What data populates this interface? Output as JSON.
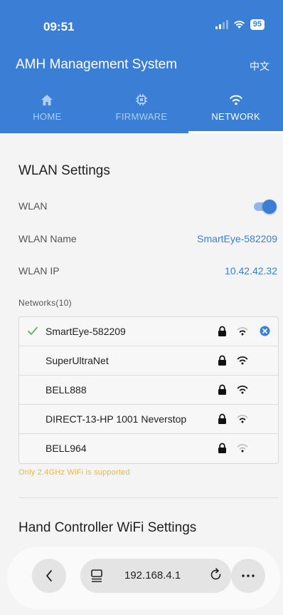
{
  "status_bar": {
    "time": "09:51",
    "battery": "95"
  },
  "app": {
    "title": "AMH Management System",
    "language": "中文"
  },
  "tabs": [
    {
      "label": "HOME",
      "icon": "home-icon"
    },
    {
      "label": "FIRMWARE",
      "icon": "chip-icon"
    },
    {
      "label": "NETWORK",
      "icon": "wifi-icon",
      "active": true
    }
  ],
  "wlan": {
    "section_title": "WLAN Settings",
    "toggle_label": "WLAN",
    "toggle_on": true,
    "name_label": "WLAN Name",
    "name_value": "SmartEye-582209",
    "ip_label": "WLAN IP",
    "ip_value": "10.42.42.32",
    "networks_label": "Networks(10)",
    "networks": [
      {
        "name": "SmartEye-582209",
        "connected": true,
        "locked": true,
        "signal": "medium"
      },
      {
        "name": "SuperUltraNet",
        "connected": false,
        "locked": true,
        "signal": "strong"
      },
      {
        "name": "BELL888",
        "connected": false,
        "locked": true,
        "signal": "strong"
      },
      {
        "name": "DIRECT-13-HP 1001 Neverstop",
        "connected": false,
        "locked": true,
        "signal": "medium"
      },
      {
        "name": "BELL964",
        "connected": false,
        "locked": true,
        "signal": "weak"
      }
    ],
    "note": "Only 2.4GHz WiFi is supported"
  },
  "hand_controller": {
    "section_title": "Hand Controller WiFi Settings"
  },
  "browser": {
    "url": "192.168.4.1"
  },
  "colors": {
    "primary": "#3a7fd5",
    "note": "#e8b845",
    "check": "#4caf50"
  }
}
